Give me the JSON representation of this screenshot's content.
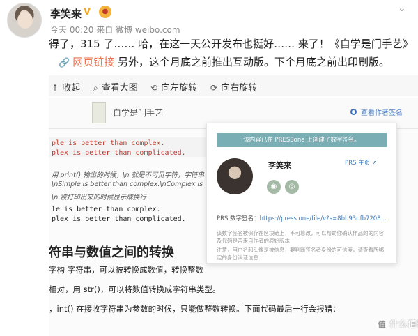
{
  "post": {
    "username": "李笑来",
    "verified_badge": "V",
    "meta": "今天 00:20 来自 微博 weibo.com",
    "text_line1": "得了，315 了…… 哈，在这一天公开发布也挺好…… 来了！《自学是门手艺》",
    "link_label": "网页链接",
    "text_line2": " 另外，这个月底之前推出互动版。下个月底之前出印刷版。"
  },
  "toolbar": {
    "collapse": "收起",
    "view_large": "查看大图",
    "rotate_left": "向左旋转",
    "rotate_right": "向右旋转"
  },
  "screenshot": {
    "book_title": "自学是门手艺",
    "view_signature": "查看作者签名",
    "code_red_1": "ple is better than complex.",
    "code_red_2": "plex is better than complicated.",
    "comment_1": "用 print() 输出的时候，\\n 就是不可见字符，字符串本",
    "comment_2": "\\nSimple is better than complex.\\nComplex is",
    "comment_3": "\\n 被打印出来的时候显示成换行",
    "code_dark_1": "le is better than complex.",
    "code_dark_2": "plex is better than complicated.",
    "heading": "符串与数值之间的转换",
    "para_1": "字构    字符串，可以被转换成数值，转换整数",
    "para_2": "相对，用 str()，可以将数值转换成字符串类型。",
    "para_3": "，int() 在接收字符串为参数的时候，只能做整数转换。下面代码最后一行会报错："
  },
  "popup": {
    "banner": "该内容已在 PRESSone 上创建了数字签名。",
    "author": "李笑来",
    "home_link": "PRS 主页",
    "sig_label": "PRS 数字签名：",
    "sig_url": "https://press.one/file/v?s=8bb93dfb7208...",
    "note_1": "该数字签名被保存在区块链上，不可篡改，可以帮助你确认作品的的内容及代码是否来自作者的原始版本",
    "note_2": "注意，用户名和头像是被信息，要判断签名者身份的可信度，请查看所绑定的身份认证信息"
  },
  "watermark": "什么值得买",
  "icons": [
    "chevron-down-icon",
    "link-icon",
    "collapse-icon",
    "zoom-icon",
    "rotate-left-icon",
    "rotate-right-icon",
    "github-icon",
    "wechat-icon",
    "external-link-icon"
  ]
}
